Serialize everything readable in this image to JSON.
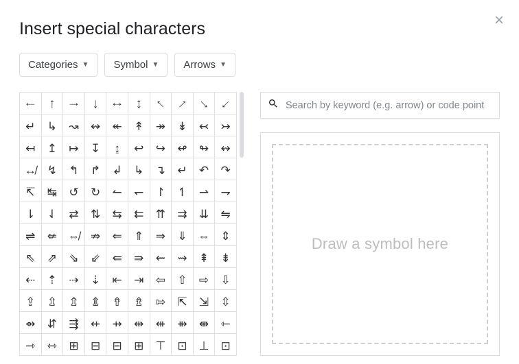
{
  "dialog": {
    "title": "Insert special characters",
    "close_label": "×"
  },
  "dropdowns": {
    "categories": "Categories",
    "symbol": "Symbol",
    "arrows": "Arrows"
  },
  "search": {
    "placeholder": "Search by keyword (e.g. arrow) or code point"
  },
  "draw": {
    "hint": "Draw a symbol here"
  },
  "grid": [
    [
      "←",
      "↑",
      "→",
      "↓",
      "↔",
      "↕",
      "↖",
      "↗",
      "↘",
      "↙"
    ],
    [
      "↵",
      "↳",
      "↝",
      "↭",
      "↞",
      "↟",
      "↠",
      "↡",
      "↢",
      "↣"
    ],
    [
      "↤",
      "↥",
      "↦",
      "↧",
      "↨",
      "↩",
      "↪",
      "↫",
      "↬",
      "↭"
    ],
    [
      "↮",
      "↯",
      "↰",
      "↱",
      "↲",
      "↳",
      "↴",
      "↵",
      "↶",
      "↷"
    ],
    [
      "↸",
      "↹",
      "↺",
      "↻",
      "↼",
      "↽",
      "↾",
      "↿",
      "⇀",
      "⇁"
    ],
    [
      "⇂",
      "⇃",
      "⇄",
      "⇅",
      "⇆",
      "⇇",
      "⇈",
      "⇉",
      "⇊",
      "⇋"
    ],
    [
      "⇌",
      "⇍",
      "⇎",
      "⇏",
      "⇐",
      "⇑",
      "⇒",
      "⇓",
      "⇔",
      "⇕"
    ],
    [
      "⇖",
      "⇗",
      "⇘",
      "⇙",
      "⇚",
      "⇛",
      "⇜",
      "⇝",
      "⇞",
      "⇟"
    ],
    [
      "⇠",
      "⇡",
      "⇢",
      "⇣",
      "⇤",
      "⇥",
      "⇦",
      "⇧",
      "⇨",
      "⇩"
    ],
    [
      "⇪",
      "⇫",
      "⇬",
      "⇭",
      "⇮",
      "⇯",
      "⇰",
      "⇱",
      "⇲",
      "⇳"
    ],
    [
      "⇴",
      "⇵",
      "⇶",
      "⇷",
      "⇸",
      "⇹",
      "⇺",
      "⇻",
      "⇼",
      "⇽"
    ],
    [
      "⇾",
      "⇿",
      "⊞",
      "⊟",
      "⊟",
      "⊞",
      "⊤",
      "⊡",
      "⊥",
      "⊡"
    ]
  ]
}
